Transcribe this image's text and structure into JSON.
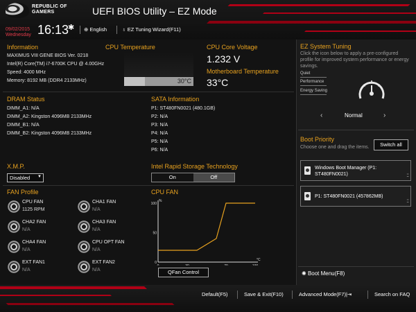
{
  "header": {
    "brand_line1": "REPUBLIC OF",
    "brand_line2": "GAMERS",
    "title": "UEFI BIOS Utility – EZ Mode",
    "date": "09/02/2015",
    "weekday": "Wednesday",
    "time": "16:13",
    "language": "English",
    "ez_tuning_wizard": "EZ Tuning Wizard(F11)"
  },
  "information": {
    "title": "Information",
    "lines": [
      "MAXIMUS VIII GENE   BIOS Ver. 0218",
      "Intel(R) Core(TM) i7-6700K CPU @ 4.00GHz",
      "Speed: 4000 MHz",
      "Memory: 8192 MB (DDR4 2133MHz)"
    ]
  },
  "cpu_temperature": {
    "title": "CPU Temperature",
    "value": "30°C",
    "fill_percent": 30
  },
  "cpu_voltage": {
    "title": "CPU Core Voltage",
    "value": "1.232 V"
  },
  "mb_temperature": {
    "title": "Motherboard Temperature",
    "value": "33°C"
  },
  "ez_tuning": {
    "title": "EZ System Tuning",
    "description": "Click the icon below to apply a pre-configured profile for improved system performance or energy savings.",
    "options": [
      "Quiet",
      "Performance",
      "Energy Saving"
    ],
    "current": "Normal",
    "prev": "‹",
    "next": "›"
  },
  "dram": {
    "title": "DRAM Status",
    "slots": [
      {
        "name": "DIMM_A1:",
        "value": "N/A"
      },
      {
        "name": "DIMM_A2:",
        "value": "Kingston 4096MB 2133MHz"
      },
      {
        "name": "DIMM_B1:",
        "value": "N/A"
      },
      {
        "name": "DIMM_B2:",
        "value": "Kingston 4096MB 2133MHz"
      }
    ]
  },
  "sata": {
    "title": "SATA Information",
    "ports": [
      {
        "name": "P1:",
        "value": "ST480FN0021 (480.1GB)"
      },
      {
        "name": "P2:",
        "value": "N/A"
      },
      {
        "name": "P3:",
        "value": "N/A"
      },
      {
        "name": "P4:",
        "value": "N/A"
      },
      {
        "name": "P5:",
        "value": "N/A"
      },
      {
        "name": "P6:",
        "value": "N/A"
      }
    ]
  },
  "xmp": {
    "title": "X.M.P.",
    "selected": "Disabled"
  },
  "rst": {
    "title": "Intel Rapid Storage Technology",
    "on": "On",
    "off": "Off",
    "selected": "Off"
  },
  "fan_profile": {
    "title": "FAN Profile",
    "fans": [
      {
        "name": "CPU FAN",
        "value": "1125 RPM"
      },
      {
        "name": "CHA1 FAN",
        "value": "N/A"
      },
      {
        "name": "CHA2 FAN",
        "value": "N/A"
      },
      {
        "name": "CHA3 FAN",
        "value": "N/A"
      },
      {
        "name": "CHA4 FAN",
        "value": "N/A"
      },
      {
        "name": "CPU OPT FAN",
        "value": "N/A"
      },
      {
        "name": "EXT FAN1",
        "value": "N/A"
      },
      {
        "name": "EXT FAN2",
        "value": "N/A"
      }
    ]
  },
  "cpu_fan_chart": {
    "title": "CPU FAN",
    "qfan_button": "QFan Control"
  },
  "chart_data": {
    "type": "line",
    "title": "CPU FAN",
    "ylabel": "%",
    "xlabel": "°C",
    "x": [
      0,
      40,
      60,
      70,
      100
    ],
    "y": [
      20,
      20,
      40,
      100,
      100
    ],
    "xlim": [
      0,
      100
    ],
    "ylim": [
      0,
      100
    ],
    "x_ticks": [
      "0",
      "30",
      "70",
      "100"
    ],
    "y_ticks": [
      "100",
      "50",
      "0"
    ],
    "line_color": "#e8a21f",
    "grid": false
  },
  "boot_priority": {
    "title": "Boot Priority",
    "description": "Choose one and drag the items.",
    "switch_all": "Switch all",
    "items": [
      {
        "line1": "Windows Boot Manager (P1:",
        "line2": "ST480FN0021)"
      },
      {
        "line1": "P1: ST480FN0021  (457862MB)",
        "line2": ""
      }
    ]
  },
  "boot_menu": "Boot Menu(F8)",
  "footer": {
    "default": "Default(F5)",
    "save_exit": "Save & Exit(F10)",
    "advanced": "Advanced Mode(F7)|",
    "search": "Search on FAQ"
  },
  "colors": {
    "accent": "#e8a21f",
    "brand_red": "#b00016",
    "date_red": "#e53b4a"
  }
}
